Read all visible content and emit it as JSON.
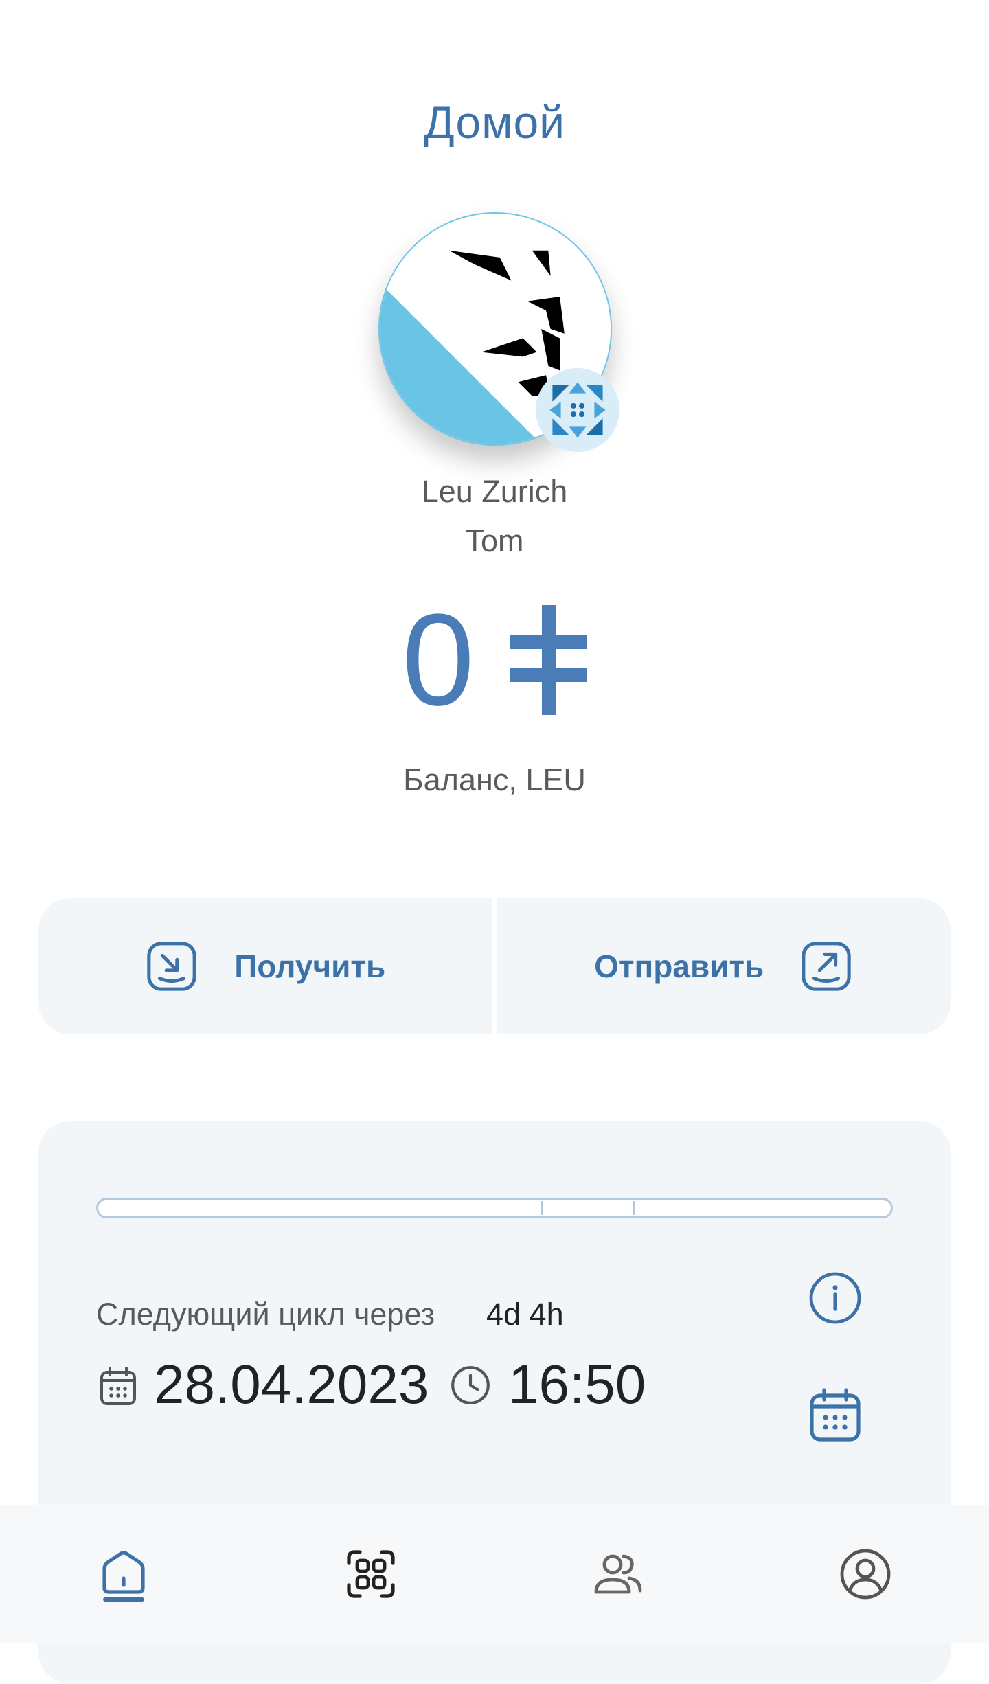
{
  "header": {
    "title": "Домой"
  },
  "profile": {
    "community_name": "Leu Zurich",
    "user_name": "Tom",
    "avatar_icon": "leu-zurich-lion-logo",
    "badge_icon": "encointer-logo-icon"
  },
  "balance": {
    "value": "0",
    "currency_icon": "leu-currency-icon",
    "label": "Баланс, LEU"
  },
  "actions": {
    "receive_label": "Получить",
    "send_label": "Отправить"
  },
  "cycle": {
    "label": "Следующий цикл через",
    "remaining": "4d 4h",
    "date": "28.04.2023",
    "time": "16:50"
  },
  "nav": {
    "items": [
      {
        "icon": "home-icon",
        "active": true
      },
      {
        "icon": "qr-scan-icon",
        "active": false
      },
      {
        "icon": "contacts-icon",
        "active": false
      },
      {
        "icon": "profile-icon",
        "active": false
      }
    ]
  },
  "colors": {
    "accent": "#3d72a8",
    "balance": "#4a7cb8",
    "card_bg": "#f3f6f8",
    "zurich_blue": "#6ac4e6"
  }
}
